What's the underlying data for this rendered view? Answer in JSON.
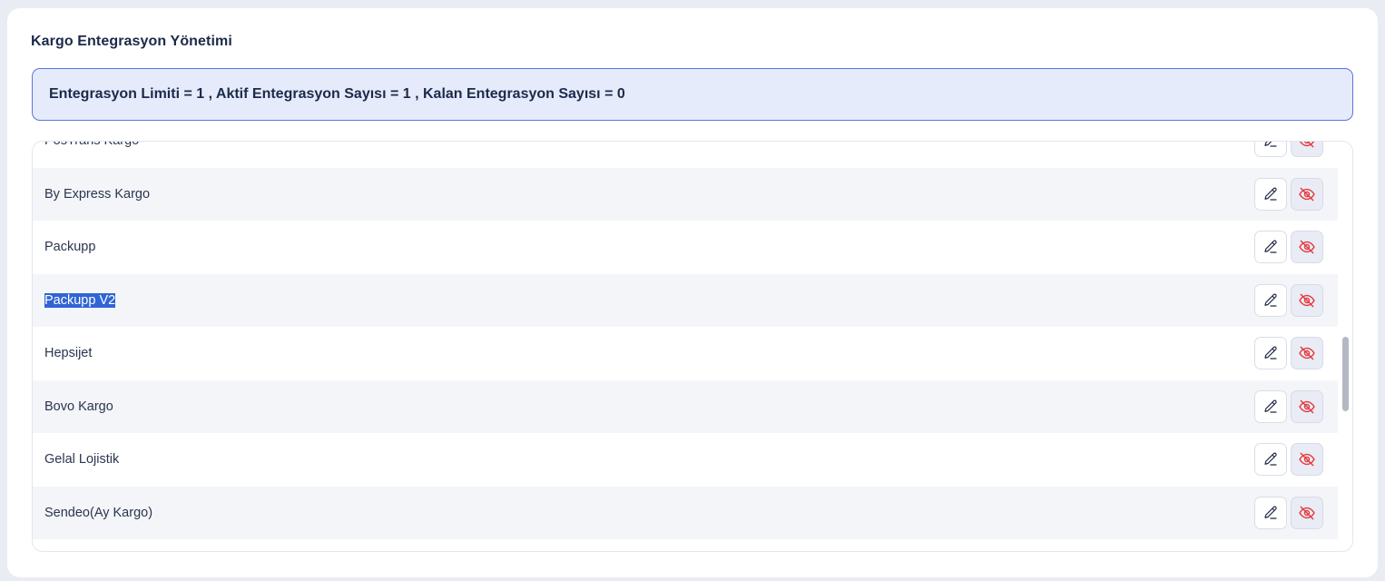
{
  "page": {
    "title": "Kargo Entegrasyon Yönetimi",
    "info_banner": "Entegrasyon Limiti = 1 , Aktif Entegrasyon Sayısı = 1 , Kalan Entegrasyon Sayısı = 0"
  },
  "integrations": [
    {
      "name": "PosTrans Kargo",
      "selected": false
    },
    {
      "name": "By Express Kargo",
      "selected": false
    },
    {
      "name": "Packupp",
      "selected": false
    },
    {
      "name": "Packupp V2",
      "selected": true
    },
    {
      "name": "Hepsijet",
      "selected": false
    },
    {
      "name": "Bovo Kargo",
      "selected": false
    },
    {
      "name": "Gelal Lojistik",
      "selected": false
    },
    {
      "name": "Sendeo(Ay Kargo)",
      "selected": false
    }
  ],
  "actions": {
    "edit_icon": "pencil-icon",
    "hide_icon": "eye-off-icon"
  },
  "colors": {
    "accent": "#5b74e0",
    "banner_bg": "#e6ebfb",
    "danger": "#e5393c",
    "selection": "#2f65d4"
  }
}
